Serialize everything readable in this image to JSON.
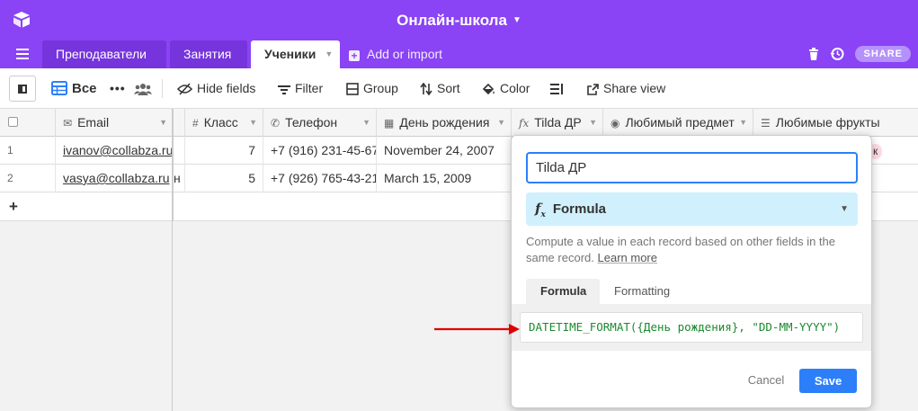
{
  "app": {
    "base_title": "Онлайн-школа",
    "share_label": "SHARE",
    "add_import_label": "Add or import"
  },
  "tabs": [
    {
      "label": "Преподаватели"
    },
    {
      "label": "Занятия"
    },
    {
      "label": "Ученики",
      "active": true
    }
  ],
  "toolbar": {
    "view_name": "Все",
    "hide_fields": "Hide fields",
    "filter": "Filter",
    "group": "Group",
    "sort": "Sort",
    "color": "Color",
    "share_view": "Share view"
  },
  "columns": [
    {
      "label": "Email"
    },
    {
      "label": "Класс"
    },
    {
      "label": "Телефон"
    },
    {
      "label": "День рождения"
    },
    {
      "label": "Tilda ДР"
    },
    {
      "label": "Любимый предмет"
    },
    {
      "label": "Любимые фрукты"
    }
  ],
  "rows": [
    {
      "num": "1",
      "email": "ivanov@collabza.ru",
      "partial": "",
      "klass": "7",
      "phone": "+7 (916) 231-45-67",
      "birthday": "November 24, 2007"
    },
    {
      "num": "2",
      "email": "vasya@collabza.ru",
      "partial": "н",
      "klass": "5",
      "phone": "+7 (926) 765-43-21",
      "birthday": "March 15, 2009"
    }
  ],
  "add_row_label": "+",
  "fruit_pill_partial": "к",
  "dialog": {
    "field_name": "Tilda ДР",
    "field_type": "Formula",
    "description": "Compute a value in each record based on other fields in the same record.",
    "learn_more": "Learn more",
    "tab_formula": "Formula",
    "tab_formatting": "Formatting",
    "formula": "DATETIME_FORMAT({День рождения}, \"DD-MM-YYYY\")",
    "cancel": "Cancel",
    "save": "Save"
  },
  "colors": {
    "brand": "#8a43f5",
    "primary_blue": "#2d7ff9",
    "formula_green": "#1c8a2e",
    "arrow_red": "#e00000"
  }
}
